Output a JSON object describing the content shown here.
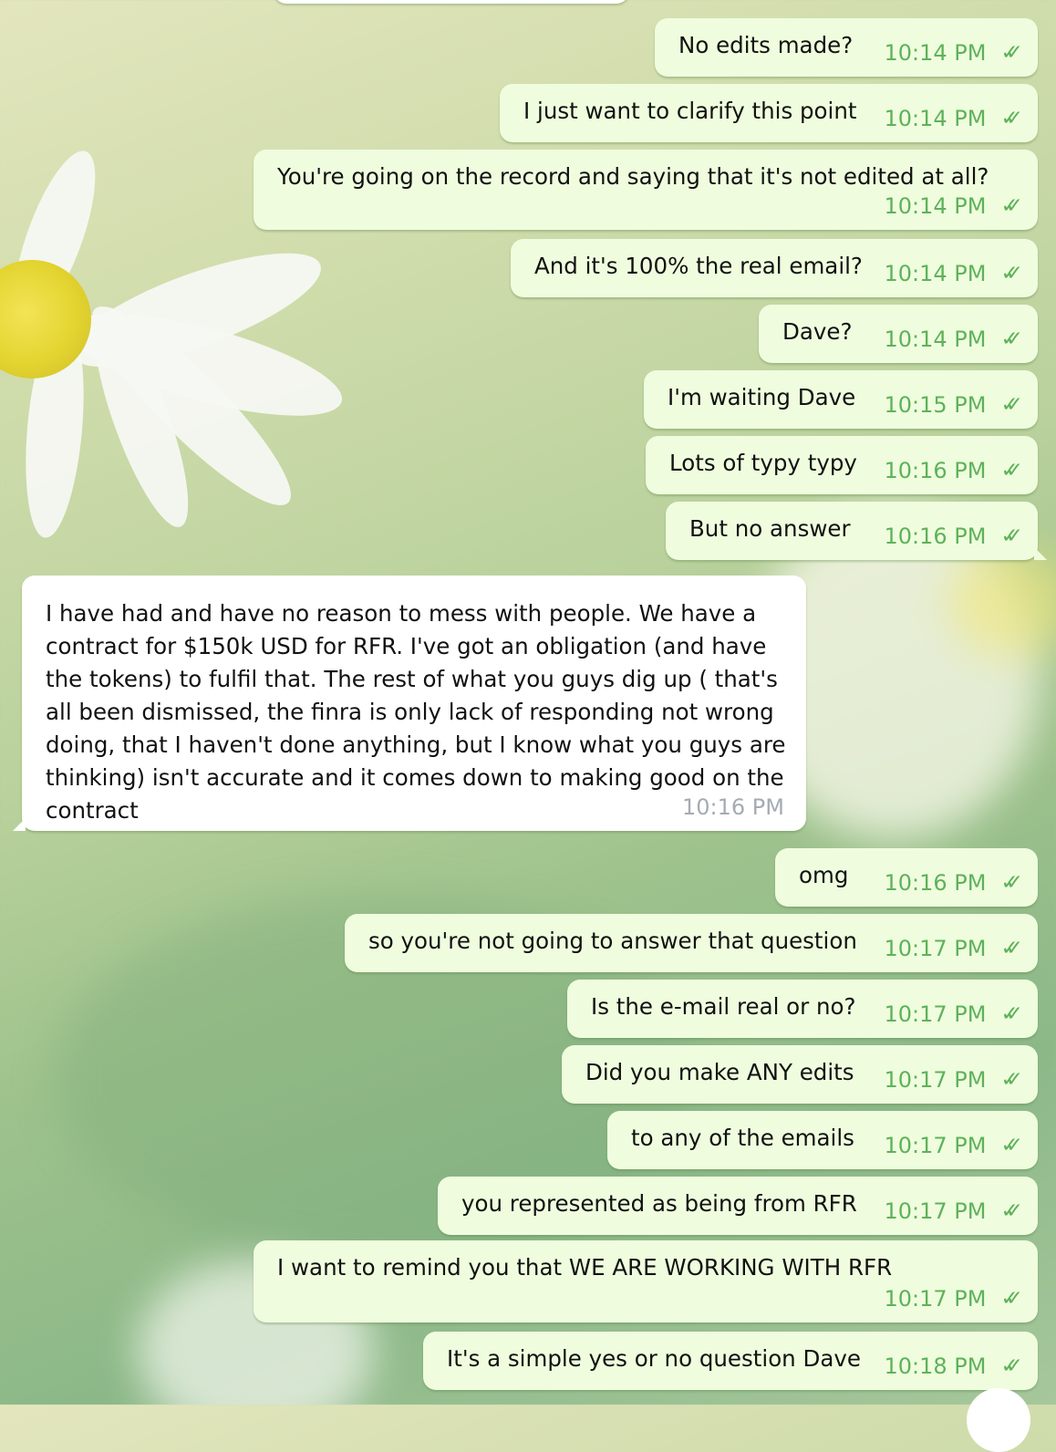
{
  "colors": {
    "outgoing_bubble": "#effdde",
    "incoming_bubble": "#ffffff",
    "outgoing_time": "#5eb25a",
    "incoming_time": "#a4abb3"
  },
  "messages": [
    {
      "direction": "out",
      "text": "No edits made?",
      "time": "10:14 PM",
      "status": "read-double-check-icon"
    },
    {
      "direction": "out",
      "text": "I just want to clarify this point",
      "time": "10:14 PM",
      "status": "read-double-check-icon"
    },
    {
      "direction": "out",
      "text": "You're going on the record and saying that it's not edited at all?",
      "time": "10:14 PM",
      "status": "read-double-check-icon"
    },
    {
      "direction": "out",
      "text": "And it's 100% the real email?",
      "time": "10:14 PM",
      "status": "read-double-check-icon"
    },
    {
      "direction": "out",
      "text": "Dave?",
      "time": "10:14 PM",
      "status": "read-double-check-icon"
    },
    {
      "direction": "out",
      "text": "I'm waiting Dave",
      "time": "10:15 PM",
      "status": "read-double-check-icon"
    },
    {
      "direction": "out",
      "text": "Lots of typy typy",
      "time": "10:16 PM",
      "status": "read-double-check-icon"
    },
    {
      "direction": "out",
      "text": "But no answer",
      "time": "10:16 PM",
      "status": "read-double-check-icon"
    },
    {
      "direction": "in",
      "text": "I have had and have no reason to mess with people. We have a contract for $150k USD for RFR. I've got an obligation (and have the tokens) to fulfil that. The rest of what you guys dig up ( that's all been dismissed, the finra is only lack of responding not wrong doing, that I haven't done anything, but I know what you guys are thinking) isn't accurate and it comes down to making good on the contract",
      "time": "10:16 PM"
    },
    {
      "direction": "out",
      "text": "omg",
      "time": "10:16 PM",
      "status": "read-double-check-icon"
    },
    {
      "direction": "out",
      "text": "so you're not going to answer that question",
      "time": "10:17 PM",
      "status": "read-double-check-icon"
    },
    {
      "direction": "out",
      "text": "Is the e-mail real or no?",
      "time": "10:17 PM",
      "status": "read-double-check-icon"
    },
    {
      "direction": "out",
      "text": "Did you make ANY edits",
      "time": "10:17 PM",
      "status": "read-double-check-icon"
    },
    {
      "direction": "out",
      "text": "to any of the emails",
      "time": "10:17 PM",
      "status": "read-double-check-icon"
    },
    {
      "direction": "out",
      "text": "you represented as being from RFR",
      "time": "10:17 PM",
      "status": "read-double-check-icon"
    },
    {
      "direction": "out",
      "text": "I want to remind you that WE ARE WORKING WITH RFR",
      "time": "10:17 PM",
      "status": "read-double-check-icon"
    },
    {
      "direction": "out",
      "text": "It's a simple yes or no question Dave",
      "time": "10:18 PM",
      "status": "read-double-check-icon"
    }
  ]
}
